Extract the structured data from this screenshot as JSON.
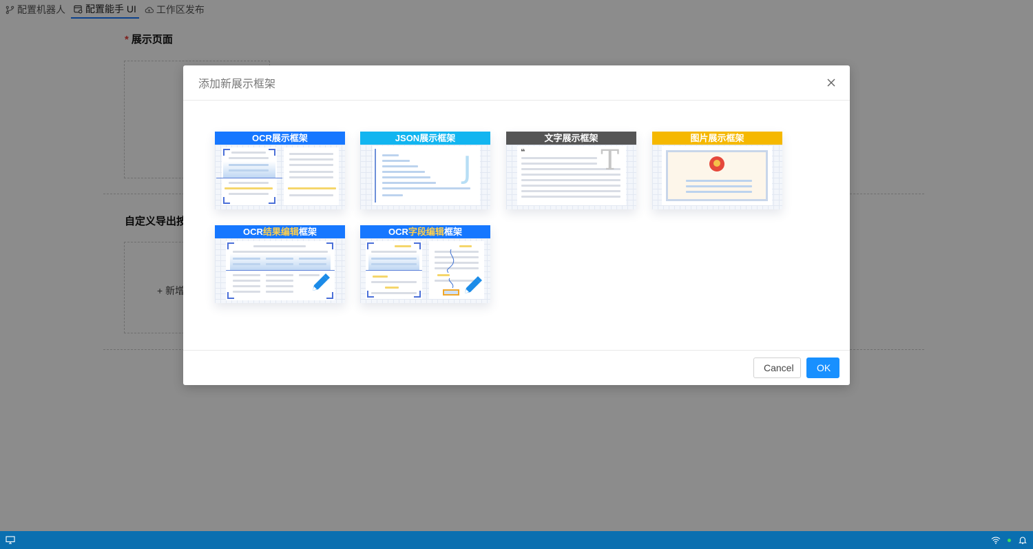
{
  "tabs": [
    {
      "label": "配置机器人",
      "icon": "branch-icon",
      "active": false
    },
    {
      "label": "配置能手 UI",
      "icon": "window-settings-icon",
      "active": true
    },
    {
      "label": "工作区发布",
      "icon": "cloud-upload-icon",
      "active": false
    }
  ],
  "page": {
    "display_section_title": "展示页面",
    "required_mark": "*",
    "export_section_title": "自定义导出按",
    "add_new_label": "+ 新增"
  },
  "modal": {
    "title": "添加新展示框架",
    "cancel_label": "Cancel",
    "ok_label": "OK",
    "cards": [
      {
        "parts": [
          {
            "text": "OCR展示框架",
            "highlight": false
          }
        ],
        "header_color": "#1677ff",
        "icon": "ocr-display-thumbnail"
      },
      {
        "parts": [
          {
            "text": "JSON展示框架",
            "highlight": false
          }
        ],
        "header_color": "#12b5f0",
        "icon": "json-display-thumbnail"
      },
      {
        "parts": [
          {
            "text": "文字展示框架",
            "highlight": false
          }
        ],
        "header_color": "#555555",
        "icon": "text-display-thumbnail"
      },
      {
        "parts": [
          {
            "text": "图片展示框架",
            "highlight": false
          }
        ],
        "header_color": "#f5b800",
        "icon": "image-display-thumbnail"
      },
      {
        "parts": [
          {
            "text": "OCR",
            "highlight": false
          },
          {
            "text": "结果编辑",
            "highlight": true
          },
          {
            "text": "框架",
            "highlight": false
          }
        ],
        "header_color": "#1677ff",
        "icon": "ocr-result-edit-thumbnail"
      },
      {
        "parts": [
          {
            "text": "OCR",
            "highlight": false
          },
          {
            "text": "字段编辑",
            "highlight": true
          },
          {
            "text": "框架",
            "highlight": false
          }
        ],
        "header_color": "#1677ff",
        "icon": "ocr-field-edit-thumbnail"
      }
    ]
  },
  "theme": {
    "accent": "#1890ff",
    "taskbar": "#0a6fb0",
    "highlight": "#ffd04d"
  }
}
